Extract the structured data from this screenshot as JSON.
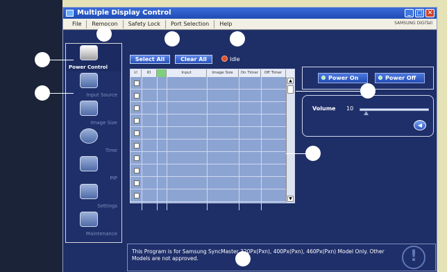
{
  "window": {
    "title": "Multiple Display Control",
    "menu": [
      "File",
      "Remocon",
      "Safety Lock",
      "Port Selection",
      "Help"
    ],
    "brand": "SAMSUNG DIGITall"
  },
  "toolbar": {
    "select_all": "Select All",
    "clear_all": "Clear All",
    "status": "Idle"
  },
  "sidebar": {
    "items": [
      {
        "label": "Power Control",
        "icon": "power-control-icon",
        "selected": true
      },
      {
        "label": "Input Source",
        "icon": "input-source-icon"
      },
      {
        "label": "Image Size",
        "icon": "image-size-icon"
      },
      {
        "label": "Time",
        "icon": "time-icon"
      },
      {
        "label": "PIP",
        "icon": "pip-icon"
      },
      {
        "label": "Settings",
        "icon": "settings-icon"
      },
      {
        "label": "Maintenance",
        "icon": "maintenance-icon"
      }
    ]
  },
  "grid": {
    "columns": [
      "",
      "ID",
      "",
      "Input",
      "Image Size",
      "On Timer",
      "Off Timer"
    ],
    "row_count": 10
  },
  "power": {
    "on_label": "Power On",
    "off_label": "Power Off"
  },
  "volume": {
    "label": "Volume",
    "value": "10"
  },
  "info": {
    "text": "This Program is for Samsung SyncMaster 320Px(Pxn), 400Px(Pxn), 460Px(Pxn)  Model Only. Other Models are not approved."
  },
  "colors": {
    "window_bg": "#1e2e66",
    "button": "#2a52b8",
    "status_dot": "#e05030",
    "callout": "#ffffff"
  }
}
